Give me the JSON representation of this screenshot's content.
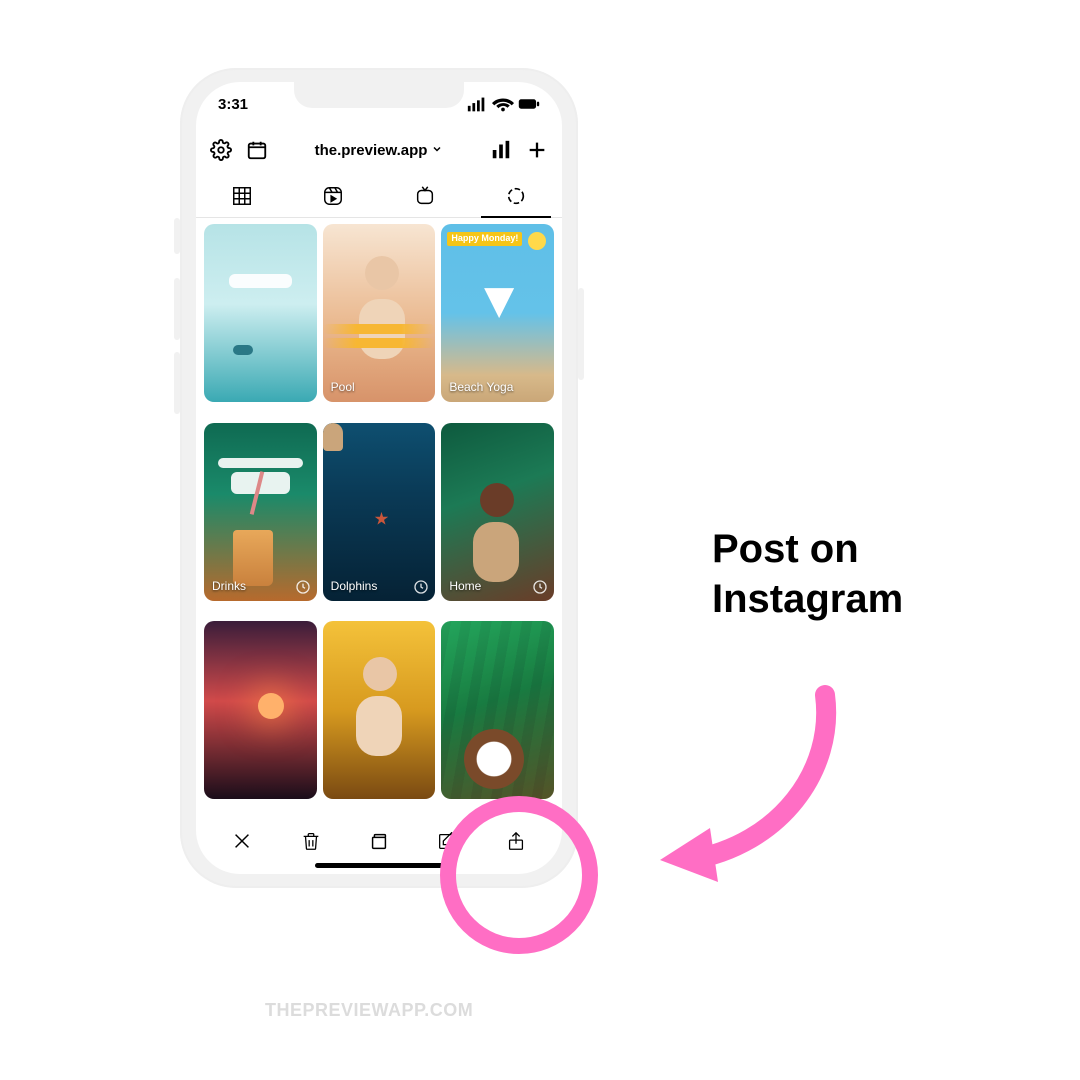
{
  "status": {
    "time": "3:31"
  },
  "header": {
    "username": "the.preview.app"
  },
  "tabs": [
    "grid",
    "reels",
    "igtv",
    "stories"
  ],
  "active_tab_index": 3,
  "stories": [
    {
      "label": "",
      "scheduled": false
    },
    {
      "label": "Pool",
      "scheduled": false
    },
    {
      "label": "Beach Yoga",
      "scheduled": false,
      "badge": "Happy Monday!"
    },
    {
      "label": "Drinks",
      "scheduled": true
    },
    {
      "label": "Dolphins",
      "scheduled": true
    },
    {
      "label": "Home",
      "scheduled": true
    },
    {
      "label": "",
      "scheduled": false
    },
    {
      "label": "",
      "scheduled": false
    },
    {
      "label": "",
      "scheduled": false
    }
  ],
  "bottom_actions": [
    "close",
    "trash",
    "stack",
    "compose",
    "share"
  ],
  "callout": {
    "line1": "Post on",
    "line2": "Instagram"
  },
  "watermark": "THEPREVIEWAPP.COM",
  "annotation_color": "#ff6ec4"
}
